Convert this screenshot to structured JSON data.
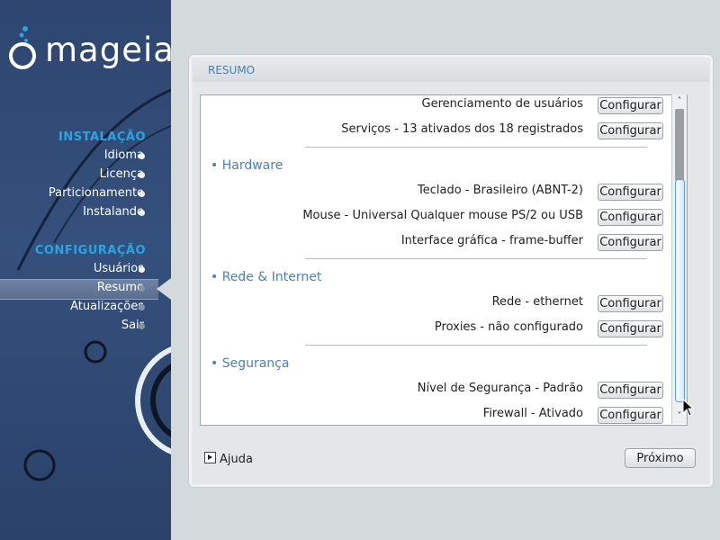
{
  "brand": {
    "logo_text": "mageia"
  },
  "sidebar": {
    "sections": [
      {
        "title": "INSTALAÇÃO",
        "items": [
          {
            "label": "Idioma",
            "state": "done"
          },
          {
            "label": "Licença",
            "state": "done"
          },
          {
            "label": "Particionamento",
            "state": "done"
          },
          {
            "label": "Instalando",
            "state": "done"
          }
        ]
      },
      {
        "title": "CONFIGURAÇÃO",
        "items": [
          {
            "label": "Usuários",
            "state": "done"
          },
          {
            "label": "Resumo",
            "state": "current"
          },
          {
            "label": "Atualizações",
            "state": "pending"
          },
          {
            "label": "Sair",
            "state": "pending"
          }
        ]
      }
    ]
  },
  "panel": {
    "title": "RESUMO",
    "groups": [
      {
        "heading": "",
        "rows": [
          {
            "label": "Gerenciamento de usuários",
            "button": "Configurar"
          },
          {
            "label": "Serviços - 13 ativados dos 18 registrados",
            "button": "Configurar"
          }
        ]
      },
      {
        "heading": "• Hardware",
        "rows": [
          {
            "label": "Teclado - Brasileiro (ABNT-2)",
            "button": "Configurar"
          },
          {
            "label": "Mouse - Universal Qualquer mouse PS/2 ou USB",
            "button": "Configurar"
          },
          {
            "label": "Interface gráfica - frame-buffer",
            "button": "Configurar"
          }
        ]
      },
      {
        "heading": "• Rede & Internet",
        "rows": [
          {
            "label": "Rede - ethernet",
            "button": "Configurar"
          },
          {
            "label": "Proxies - não configurado",
            "button": "Configurar"
          }
        ]
      },
      {
        "heading": "• Segurança",
        "rows": [
          {
            "label": "Nível de Segurança - Padrão",
            "button": "Configurar"
          },
          {
            "label": "Firewall - Ativado",
            "button": "Configurar"
          }
        ]
      }
    ],
    "help_label": "Ajuda",
    "next_label": "Próximo"
  },
  "colors": {
    "accent": "#2ba4e3",
    "section_heading": "#4a80c3",
    "sidebar_bg": "#2e4670"
  }
}
